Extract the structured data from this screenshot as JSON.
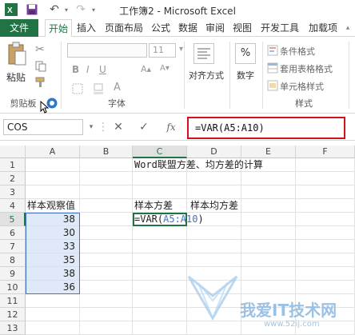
{
  "window": {
    "title": "工作簿2 - Microsoft Excel"
  },
  "tabs": [
    "文件",
    "开始",
    "插入",
    "页面布局",
    "公式",
    "数据",
    "审阅",
    "视图",
    "开发工具",
    "加载项"
  ],
  "ribbon": {
    "clipboard": {
      "paste": "粘贴",
      "group": "剪贴板"
    },
    "font": {
      "size": "11",
      "group": "字体"
    },
    "alignment": {
      "label": "对齐方式"
    },
    "number": {
      "label": "数字",
      "format_symbol": "%"
    },
    "styles": {
      "conditional": "条件格式",
      "table_format": "套用表格格式",
      "cell_style": "单元格样式",
      "group": "样式"
    }
  },
  "formula_bar": {
    "name_box": "COS",
    "cancel": "✕",
    "enter": "✓",
    "fx": "fx",
    "formula": "=VAR(A5:A10)"
  },
  "columns": [
    "A",
    "B",
    "C",
    "D",
    "E",
    "F"
  ],
  "rows": [
    "1",
    "2",
    "3",
    "4",
    "5",
    "6",
    "7",
    "8",
    "9",
    "10",
    "11",
    "12",
    "13"
  ],
  "cells": {
    "c1": "Word联盟方差、均方差的计算",
    "a4": "样本观察值",
    "c4": "样本方差",
    "d4": "样本均方差",
    "c5_prefix": "=VAR(",
    "c5_ref": "A5:A10",
    "c5_suffix": ")",
    "a_values": [
      "38",
      "30",
      "33",
      "35",
      "38",
      "36"
    ]
  },
  "watermark": {
    "text": "我爱IT技术网",
    "url": "www.52ij.com"
  }
}
